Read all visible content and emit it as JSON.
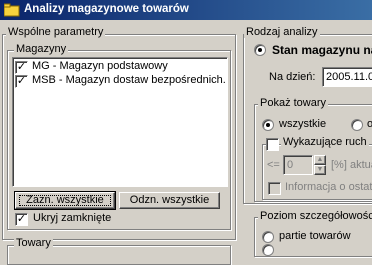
{
  "window": {
    "title": "Analizy magazynowe towarów",
    "icon": "app-folder-icon"
  },
  "left": {
    "shared_params_label": "Wspólne parametry",
    "warehouses_label": "Magazyny",
    "warehouses": [
      {
        "label": "MG - Magazyn podstawowy",
        "checked": true
      },
      {
        "label": "MSB - Magazyn dostaw bezpośrednich.",
        "checked": true
      }
    ],
    "select_all_label": "Zazn. wszystkie",
    "deselect_all_label": "Odzn. wszystkie",
    "hide_closed_label": "Ukryj zamknięte",
    "hide_closed_checked": true,
    "products_label": "Towary"
  },
  "right": {
    "analysis_type_label": "Rodzaj analizy",
    "stock_status_label": "Stan magazynu na",
    "on_day_label": "Na dzień:",
    "date_value": "2005.11.0",
    "show_products_label": "Pokaż towary",
    "all_label": "wszystkie",
    "other_option_label": "o",
    "with_movement_label": "Wykazujące ruch",
    "le_label": "<=",
    "spin_value": "0",
    "percent_label": "[%] aktua",
    "info_label": "Informacja o ostatn",
    "detail_level_label": "Poziom szczegółowośc",
    "batches_label": "partie towarów"
  }
}
